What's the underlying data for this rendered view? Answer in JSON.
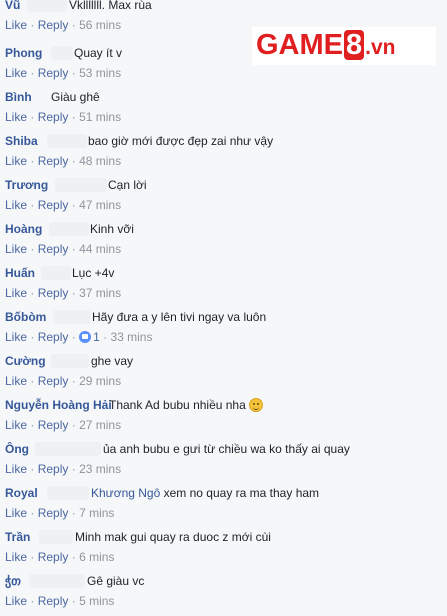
{
  "actions": {
    "like": "Like",
    "reply": "Reply",
    "sep": "·"
  },
  "logo": {
    "prefix": "GAME",
    "number": "8",
    "suffix": ".vn"
  },
  "comments": [
    {
      "name": "Vũ",
      "text": "Vklllllll. Max rùa",
      "time": "56 mins"
    },
    {
      "name": "Phong",
      "text": "Quay ít v",
      "time": "53 mins"
    },
    {
      "name": "Bình",
      "text": "Giàu ghê",
      "time": "51 mins"
    },
    {
      "name": "Shiba",
      "text": "bao giờ mới được đẹp zai như vậy",
      "time": "48 mins"
    },
    {
      "name": "Trương",
      "text": "Cạn lời",
      "time": "47 mins"
    },
    {
      "name": "Hoàng",
      "text": "Kinh vỡi",
      "time": "44 mins"
    },
    {
      "name": "Huấn",
      "text": "Lục +4v",
      "time": "37 mins"
    },
    {
      "name": "Bốbòm",
      "text": "Hãy đưa a y lên tivi ngay va luôn",
      "reactions": "1",
      "time": "33 mins"
    },
    {
      "name": "Cường",
      "text": "ghe vay",
      "time": "29 mins"
    },
    {
      "name": "Nguyễn Hoàng Hải",
      "text": "Thank Ad bubu nhiều nha",
      "time": "27 mins"
    },
    {
      "name": "Ông",
      "text": "ủa anh bubu e gưi từ chiều wa ko thấy ai quay",
      "time": "23 mins"
    },
    {
      "name": "Royal",
      "tag": "Khương Ngô",
      "text": "xem no quay ra ma thay ham",
      "time": "7 mins"
    },
    {
      "name": "Trần",
      "text": "Minh mak gui quay ra duoc z mới cùi",
      "time": "6 mins"
    },
    {
      "name": "ჭთ",
      "text": "Gê giàu vc",
      "time": "5 mins"
    }
  ]
}
